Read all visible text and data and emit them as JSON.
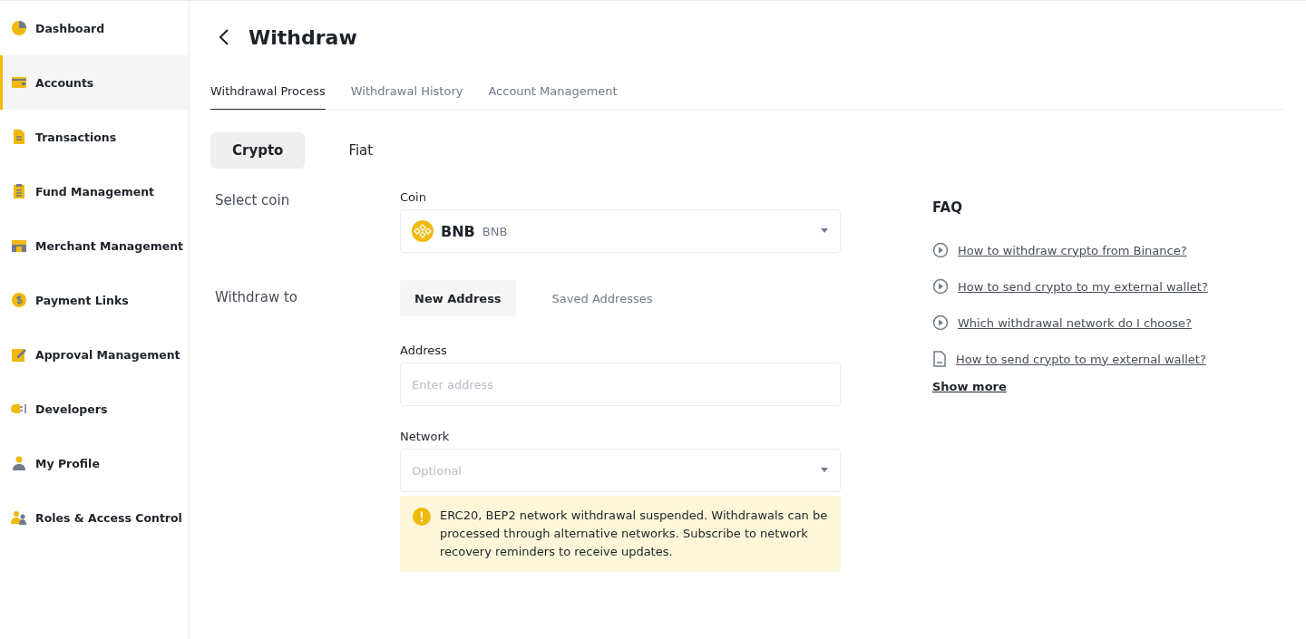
{
  "sidebar": {
    "items": [
      {
        "label": "Dashboard",
        "selected": false
      },
      {
        "label": "Accounts",
        "selected": true
      },
      {
        "label": "Transactions",
        "selected": false
      },
      {
        "label": "Fund Management",
        "selected": false
      },
      {
        "label": "Merchant Management",
        "selected": false
      },
      {
        "label": "Payment Links",
        "selected": false
      },
      {
        "label": "Approval Management",
        "selected": false
      },
      {
        "label": "Developers",
        "selected": false
      },
      {
        "label": "My Profile",
        "selected": false
      },
      {
        "label": "Roles & Access Control",
        "selected": false
      }
    ]
  },
  "page": {
    "title": "Withdraw"
  },
  "tabs": [
    {
      "label": "Withdrawal Process",
      "selected": true
    },
    {
      "label": "Withdrawal History",
      "selected": false
    },
    {
      "label": "Account Management",
      "selected": false
    }
  ],
  "type_toggle": [
    {
      "label": "Crypto",
      "selected": true
    },
    {
      "label": "Fiat",
      "selected": false
    }
  ],
  "select_coin": {
    "label": "Select coin",
    "field_label": "Coin",
    "symbol": "BNB",
    "name": "BNB"
  },
  "withdraw_to": {
    "label": "Withdraw to",
    "options": [
      {
        "label": "New Address",
        "selected": true
      },
      {
        "label": "Saved Addresses",
        "selected": false
      }
    ],
    "address": {
      "label": "Address",
      "placeholder": "Enter address"
    },
    "network": {
      "label": "Network",
      "placeholder": "Optional"
    },
    "notice": "ERC20, BEP2 network withdrawal suspended. Withdrawals can be processed through alternative networks. Subscribe to network recovery reminders to receive updates."
  },
  "faq": {
    "title": "FAQ",
    "items": [
      {
        "kind": "video",
        "label": "How to withdraw crypto from Binance?"
      },
      {
        "kind": "video",
        "label": "How to send crypto to my external wallet?"
      },
      {
        "kind": "video",
        "label": "Which withdrawal network do I choose?"
      },
      {
        "kind": "article",
        "label": "How to send crypto to my external wallet?"
      }
    ],
    "more": "Show more"
  }
}
